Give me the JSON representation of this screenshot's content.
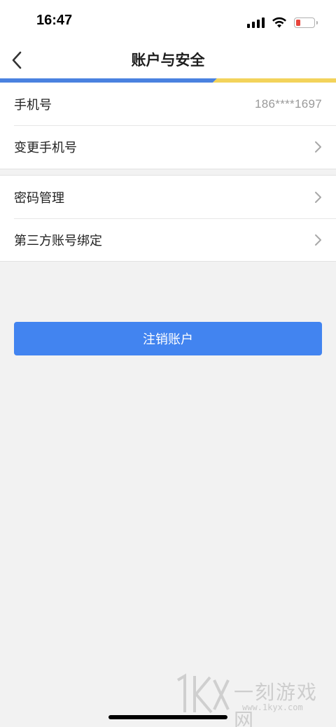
{
  "status_bar": {
    "time": "16:47",
    "icons": [
      "signal-icon",
      "wifi-icon",
      "battery-icon"
    ],
    "battery_color": "#e8453c"
  },
  "nav": {
    "title": "账户与安全",
    "back_icon": "chevron-left-icon",
    "accent_colors": [
      "#4a82e0",
      "#f3d35b"
    ]
  },
  "sections": {
    "account": {
      "phone_label": "手机号",
      "phone_value": "186****1697",
      "change_phone_label": "变更手机号"
    },
    "security": {
      "password_label": "密码管理",
      "third_party_label": "第三方账号绑定"
    }
  },
  "actions": {
    "logout_label": "注销账户",
    "logout_color": "#4284f0"
  },
  "watermark": {
    "logo_text": "1KX",
    "text": "一刻游戏网",
    "url": "www.1kyx.com"
  }
}
